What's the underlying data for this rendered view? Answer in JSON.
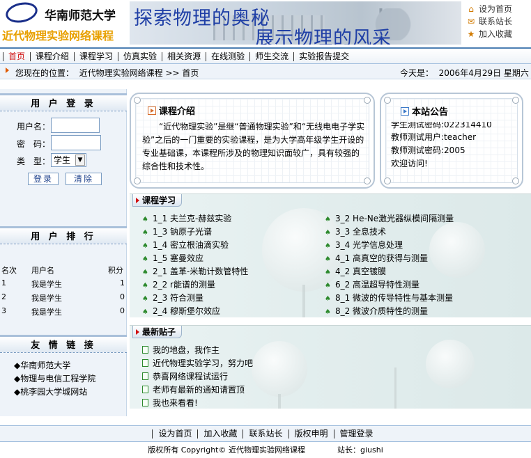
{
  "header": {
    "university": "华南师范大学",
    "course": "近代物理实验网络课程",
    "banner_line1": "探索物理的奥秘",
    "banner_line2": "展示物理的风采",
    "quick_links": [
      {
        "label": "设为首页",
        "icon": "home-icon"
      },
      {
        "label": "联系站长",
        "icon": "mail-icon"
      },
      {
        "label": "加入收藏",
        "icon": "bookmark-icon"
      }
    ]
  },
  "nav": {
    "items": [
      "首页",
      "课程介绍",
      "课程学习",
      "仿真实验",
      "相关资源",
      "在线测验",
      "师生交流",
      "实验报告提交"
    ],
    "active_index": 0
  },
  "location": {
    "label": "您现在的位置：",
    "path": "近代物理实验网络课程 >> 首页",
    "today_label": "今天是：",
    "date": "2006年4月29日 星期六"
  },
  "login": {
    "title": "用 户 登 录",
    "username_label": "用户名：",
    "password_label": "密　码：",
    "type_label": "类　型：",
    "type_value": "学生",
    "login_button": "登录",
    "clear_button": "清除"
  },
  "ranking": {
    "title": "用 户 排 行",
    "columns": [
      "名次",
      "用户名",
      "积分"
    ],
    "rows": [
      {
        "rank": "1",
        "name": "我是学生",
        "score": "1"
      },
      {
        "rank": "2",
        "name": "我是学生",
        "score": "0"
      },
      {
        "rank": "3",
        "name": "我是学生",
        "score": "0"
      }
    ]
  },
  "links": {
    "title": "友 情 链 接",
    "items": [
      "◆华南师范大学",
      "◆物理与电信工程学院",
      "◆桃李园大学城网站"
    ]
  },
  "intro": {
    "title": "课程介绍",
    "text": "“近代物理实验”是继“普通物理实验”和“无线电电子学实验”之后的一门重要的实验课程，是为大学高年级学生开设的专业基础课，本课程所涉及的物理知识面较广，具有较强的综合性和技术性。"
  },
  "notice": {
    "title": "本站公告",
    "lines": [
      "学生测试密码:022314410",
      "教师测试用户:teacher",
      "教师测试密码:2005",
      "欢迎访问!"
    ]
  },
  "study": {
    "title": "课程学习",
    "left": [
      "1_1 夫兰克-赫兹实验",
      "1_3 钠原子光谱",
      "1_4 密立根油滴实验",
      "1_5 塞曼效应",
      "2_1 盖革-米勒计数管特性",
      "2_2 r能谱的测量",
      "2_3 符合测量",
      "2_4 穆斯堡尔效应"
    ],
    "right": [
      "3_2 He-Ne激光器纵模间隔测量",
      "3_3 全息技术",
      "3_4 光学信息处理",
      "4_1 高真空的获得与测量",
      "4_2 真空镀膜",
      "6_2 高温超导特性测量",
      "8_1 微波的传导特性与基本测量",
      "8_2 微波介质特性的测量"
    ]
  },
  "posts": {
    "title": "最新贴子",
    "items": [
      "我的地盘，我作主",
      "近代物理实验学习，努力吧",
      "恭喜网络课程试运行",
      "老师有最新的通知请置顶",
      "我也来看看!"
    ]
  },
  "footer": {
    "links": [
      "设为首页",
      "加入收藏",
      "联系站长",
      "版权申明",
      "管理登录"
    ],
    "copyright": "版权所有 Copyright© 近代物理实验网络课程",
    "admin": "站长：giushi"
  }
}
